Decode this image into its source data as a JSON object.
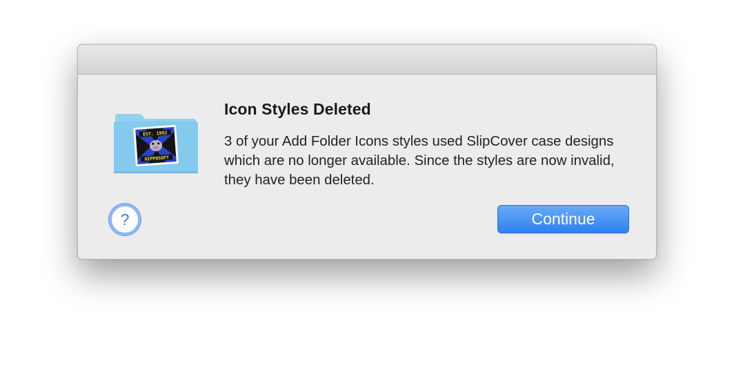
{
  "dialog": {
    "heading": "Icon Styles Deleted",
    "message": "3 of your Add Folder Icons styles used SlipCover case designs which are no longer available. Since the styles are now invalid, they have been deleted.",
    "help_label": "?",
    "continue_label": "Continue",
    "icon": "folder-icon",
    "badge_text": {
      "top": "EST. 1992",
      "bottom": "HIPPOSOFT"
    }
  },
  "colors": {
    "accent": "#3d86f3",
    "folder": "#82cdf0",
    "background": "#ececec"
  }
}
